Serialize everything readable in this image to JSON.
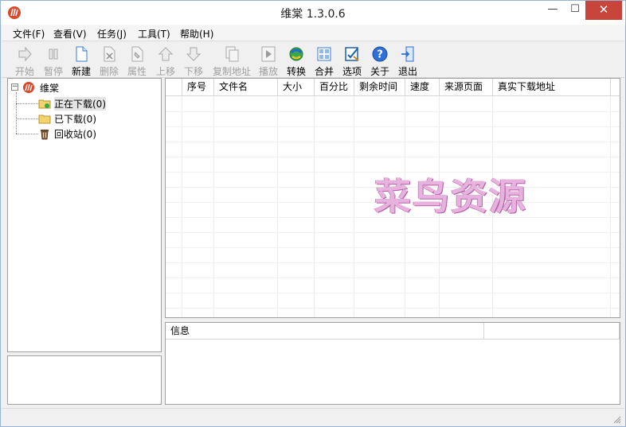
{
  "window": {
    "title": "维棠 1.3.0.6",
    "controls": {
      "minimize": "—",
      "maximize": "☐",
      "close": "✕"
    }
  },
  "menu": [
    {
      "label": "文件(F)"
    },
    {
      "label": "查看(V)"
    },
    {
      "label": "任务(J)"
    },
    {
      "label": "工具(T)"
    },
    {
      "label": "帮助(H)"
    }
  ],
  "toolbar": [
    {
      "label": "开始",
      "icon": "play-arrow-icon",
      "enabled": false
    },
    {
      "label": "暂停",
      "icon": "pause-icon",
      "enabled": false
    },
    {
      "label": "新建",
      "icon": "new-document-icon",
      "enabled": true
    },
    {
      "label": "删除",
      "icon": "delete-icon",
      "enabled": false
    },
    {
      "label": "属性",
      "icon": "properties-icon",
      "enabled": false
    },
    {
      "label": "上移",
      "icon": "move-up-icon",
      "enabled": false
    },
    {
      "label": "下移",
      "icon": "move-down-icon",
      "enabled": false
    },
    {
      "label": "复制地址",
      "icon": "copy-address-icon",
      "enabled": false
    },
    {
      "label": "播放",
      "icon": "play-media-icon",
      "enabled": false
    },
    {
      "label": "转换",
      "icon": "convert-icon",
      "enabled": true
    },
    {
      "label": "合并",
      "icon": "merge-icon",
      "enabled": true
    },
    {
      "label": "选项",
      "icon": "options-icon",
      "enabled": true
    },
    {
      "label": "关于",
      "icon": "about-icon",
      "enabled": true
    },
    {
      "label": "退出",
      "icon": "exit-icon",
      "enabled": true
    }
  ],
  "tree": {
    "root": {
      "label": "维棠",
      "expander": "−"
    },
    "children": [
      {
        "label": "正在下载(0)",
        "icon": "downloading-folder-icon"
      },
      {
        "label": "已下载(0)",
        "icon": "folder-icon"
      },
      {
        "label": "回收站(0)",
        "icon": "recycle-bin-icon"
      }
    ]
  },
  "task_list": {
    "columns": [
      "序号",
      "文件名",
      "大小",
      "百分比",
      "剩余时间",
      "速度",
      "来源页面",
      "真实下载地址"
    ],
    "rows": []
  },
  "watermark": "菜鸟资源",
  "info_panel": {
    "columns": [
      "信息",
      ""
    ]
  },
  "colors": {
    "close_button": "#c7453b",
    "watermark_fill": "#e7b3de",
    "watermark_outline": "#b45fa8",
    "disabled_text": "#a0a0a0"
  }
}
